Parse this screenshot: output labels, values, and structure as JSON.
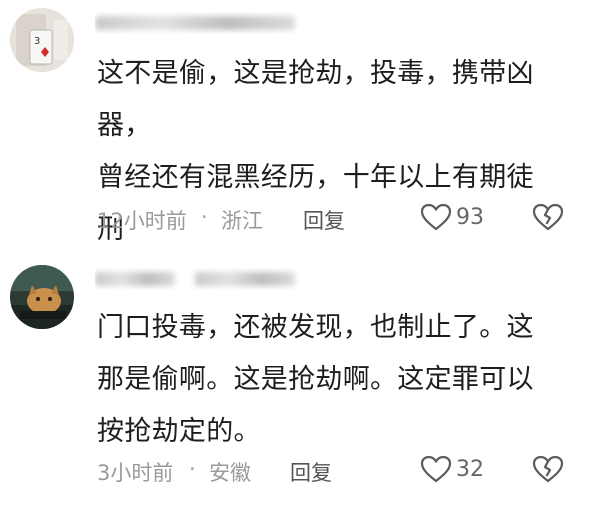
{
  "comments": [
    {
      "text_lines": [
        "这不是偷，这是抢劫，投毒，携带凶器，",
        "曾经还有混黑经历，十年以上有期徒",
        "刑"
      ],
      "time": "12小时前",
      "separator": "·",
      "location": "浙江",
      "reply_label": "回复",
      "like_count": "93",
      "icons": {
        "like": "heart-outline-icon",
        "dislike": "broken-heart-icon"
      }
    },
    {
      "text_lines": [
        "门口投毒，还被发现，也制止了。这",
        "那是偷啊。这是抢劫啊。这定罪可以",
        "按抢劫定的。"
      ],
      "time": "3小时前",
      "separator": "·",
      "location": "安徽",
      "reply_label": "回复",
      "like_count": "32",
      "icons": {
        "like": "heart-outline-icon",
        "dislike": "broken-heart-icon"
      }
    }
  ],
  "colors": {
    "text": "#1e1e1e",
    "meta": "#9a9a9a",
    "reply": "#555555",
    "icon": "#5a5a5a"
  }
}
